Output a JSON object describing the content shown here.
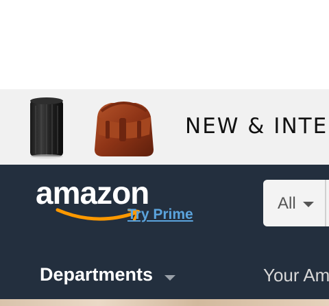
{
  "promo_banner": {
    "headline": "NEW & INTE",
    "products": [
      {
        "icon": "cylindrical-speaker-product-image"
      },
      {
        "icon": "leather-satchel-product-image"
      }
    ]
  },
  "header": {
    "logo_text": "amazon",
    "try_prime_label": "Try Prime",
    "search_category": "All"
  },
  "nav": {
    "departments_label": "Departments",
    "your_amazon_label": "Your Am"
  },
  "colors": {
    "nav_background": "#232f3e",
    "banner_background": "#f1f1f1",
    "logo_smile": "#ff9900",
    "prime_link": "#5ba4dd"
  }
}
